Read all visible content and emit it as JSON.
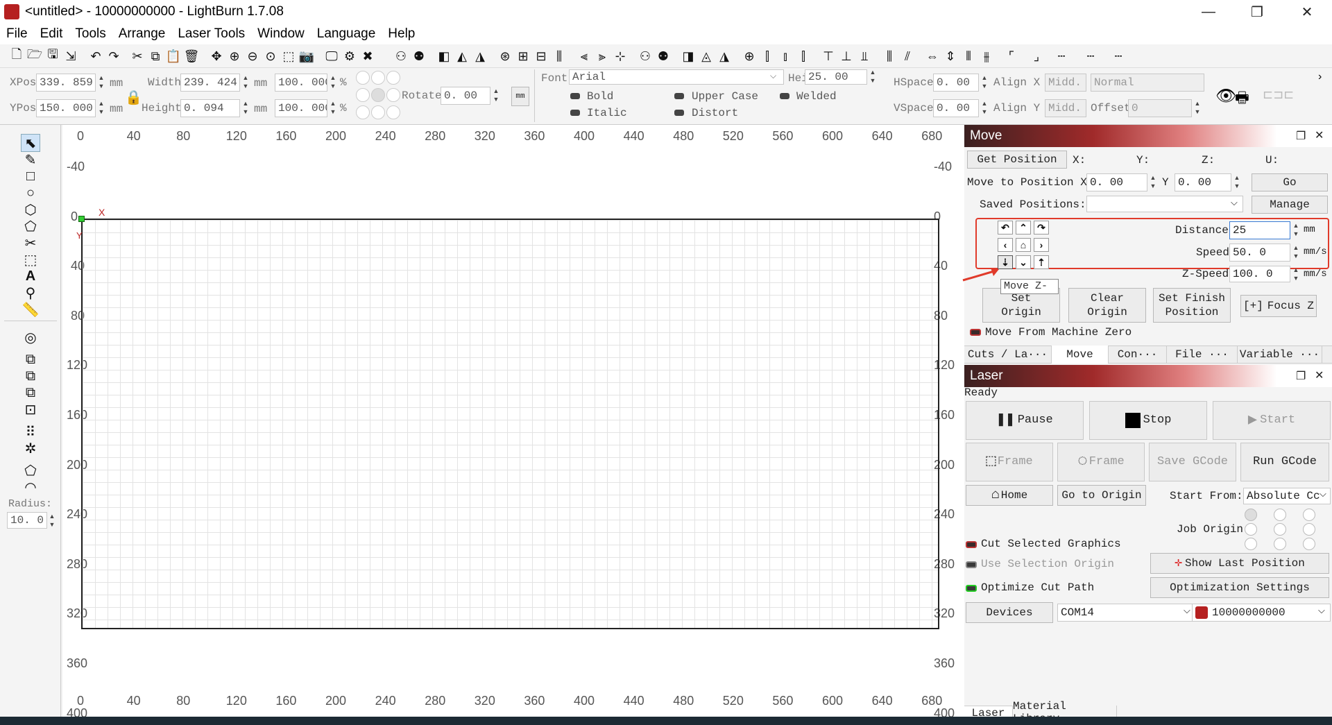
{
  "window": {
    "title": "<untitled> - 10000000000 - LightBurn 1.7.08",
    "minimize": "—",
    "maximize": "❐",
    "close": "✕"
  },
  "menu": [
    "File",
    "Edit",
    "Tools",
    "Arrange",
    "Laser Tools",
    "Window",
    "Language",
    "Help"
  ],
  "props": {
    "xpos_label": "XPos",
    "xpos": "339. 859",
    "ypos_label": "YPos",
    "ypos": "150. 000",
    "width_label": "Width",
    "width": "239. 424",
    "height_label": "Height",
    "height": "0. 094",
    "unit": "mm",
    "scale_w": "100. 000",
    "scale_h": "100. 000",
    "pct": "%",
    "rotate_label": "Rotate",
    "rotate": "0. 00",
    "mm_btn": "mm",
    "font_label": "Font",
    "font": "Arial",
    "font_height_label": "Height",
    "font_height": "25. 00",
    "hspace_label": "HSpace",
    "hspace": "0. 00",
    "vspace_label": "VSpace",
    "vspace": "0. 00",
    "alignx_label": "Align X",
    "alignx": "Midd.",
    "aligny_label": "Align Y",
    "aligny": "Midd.",
    "normal": "Normal",
    "offset_label": "Offset",
    "offset": "0",
    "bold": "Bold",
    "italic": "Italic",
    "upper": "Upper Case",
    "distort": "Distort",
    "welded": "Welded"
  },
  "left": {
    "radius_label": "Radius:",
    "radius": "10. 0"
  },
  "canvas": {
    "top_ticks": [
      "0",
      "40",
      "80",
      "120",
      "160",
      "200",
      "240",
      "280",
      "320",
      "360",
      "400",
      "440",
      "480",
      "520",
      "560",
      "600",
      "640",
      "680"
    ],
    "side_ticks": [
      "-40",
      "0",
      "40",
      "80",
      "120",
      "160",
      "200",
      "240",
      "280",
      "320",
      "360",
      "400"
    ],
    "origin_x": "X",
    "origin_y": "Y"
  },
  "move": {
    "title": "Move",
    "get_position": "Get Position",
    "x": "X:",
    "y": "Y:",
    "z": "Z:",
    "u": "U:",
    "move_to": "Move to Position X",
    "mx": "0. 00",
    "ylab": "Y",
    "my": "0. 00",
    "go": "Go",
    "saved": "Saved Positions:",
    "manage": "Manage",
    "distance_label": "Distance",
    "distance": "25",
    "speed_label": "Speed",
    "speed": "50. 0",
    "zspeed_label": "Z-Speed",
    "zspeed": "100. 0",
    "mm": "mm",
    "mms": "mm/s",
    "tooltip": "Move Z-",
    "set_origin": "Set\nOrigin",
    "clear_origin": "Clear\nOrigin",
    "set_finish": "Set Finish\nPosition",
    "focus_z": "Focus Z",
    "from_zero": "Move From Machine Zero",
    "tabs": [
      "Cuts / La···",
      "Move",
      "Con···",
      "File ···",
      "Variable ···"
    ]
  },
  "laser": {
    "title": "Laser",
    "status": "Ready",
    "pause": "Pause",
    "stop": "Stop",
    "start": "Start",
    "frame1": "Frame",
    "frame2": "Frame",
    "save_gcode": "Save GCode",
    "run_gcode": "Run GCode",
    "home": "Home",
    "go_origin": "Go to Origin",
    "start_from": "Start From:",
    "start_from_val": "Absolute Cc",
    "job_origin": "Job Origin",
    "cut_selected": "Cut Selected Graphics",
    "use_sel": "Use Selection Origin",
    "show_last": "Show Last Position",
    "optimize": "Optimize Cut Path",
    "opt_settings": "Optimization Settings",
    "devices": "Devices",
    "port": "COM14",
    "device": "10000000000"
  },
  "bottom_tabs": [
    "Laser",
    "Material Library"
  ],
  "colors": {
    "accent": "#a02a2a",
    "highlight": "#e03a2a"
  }
}
